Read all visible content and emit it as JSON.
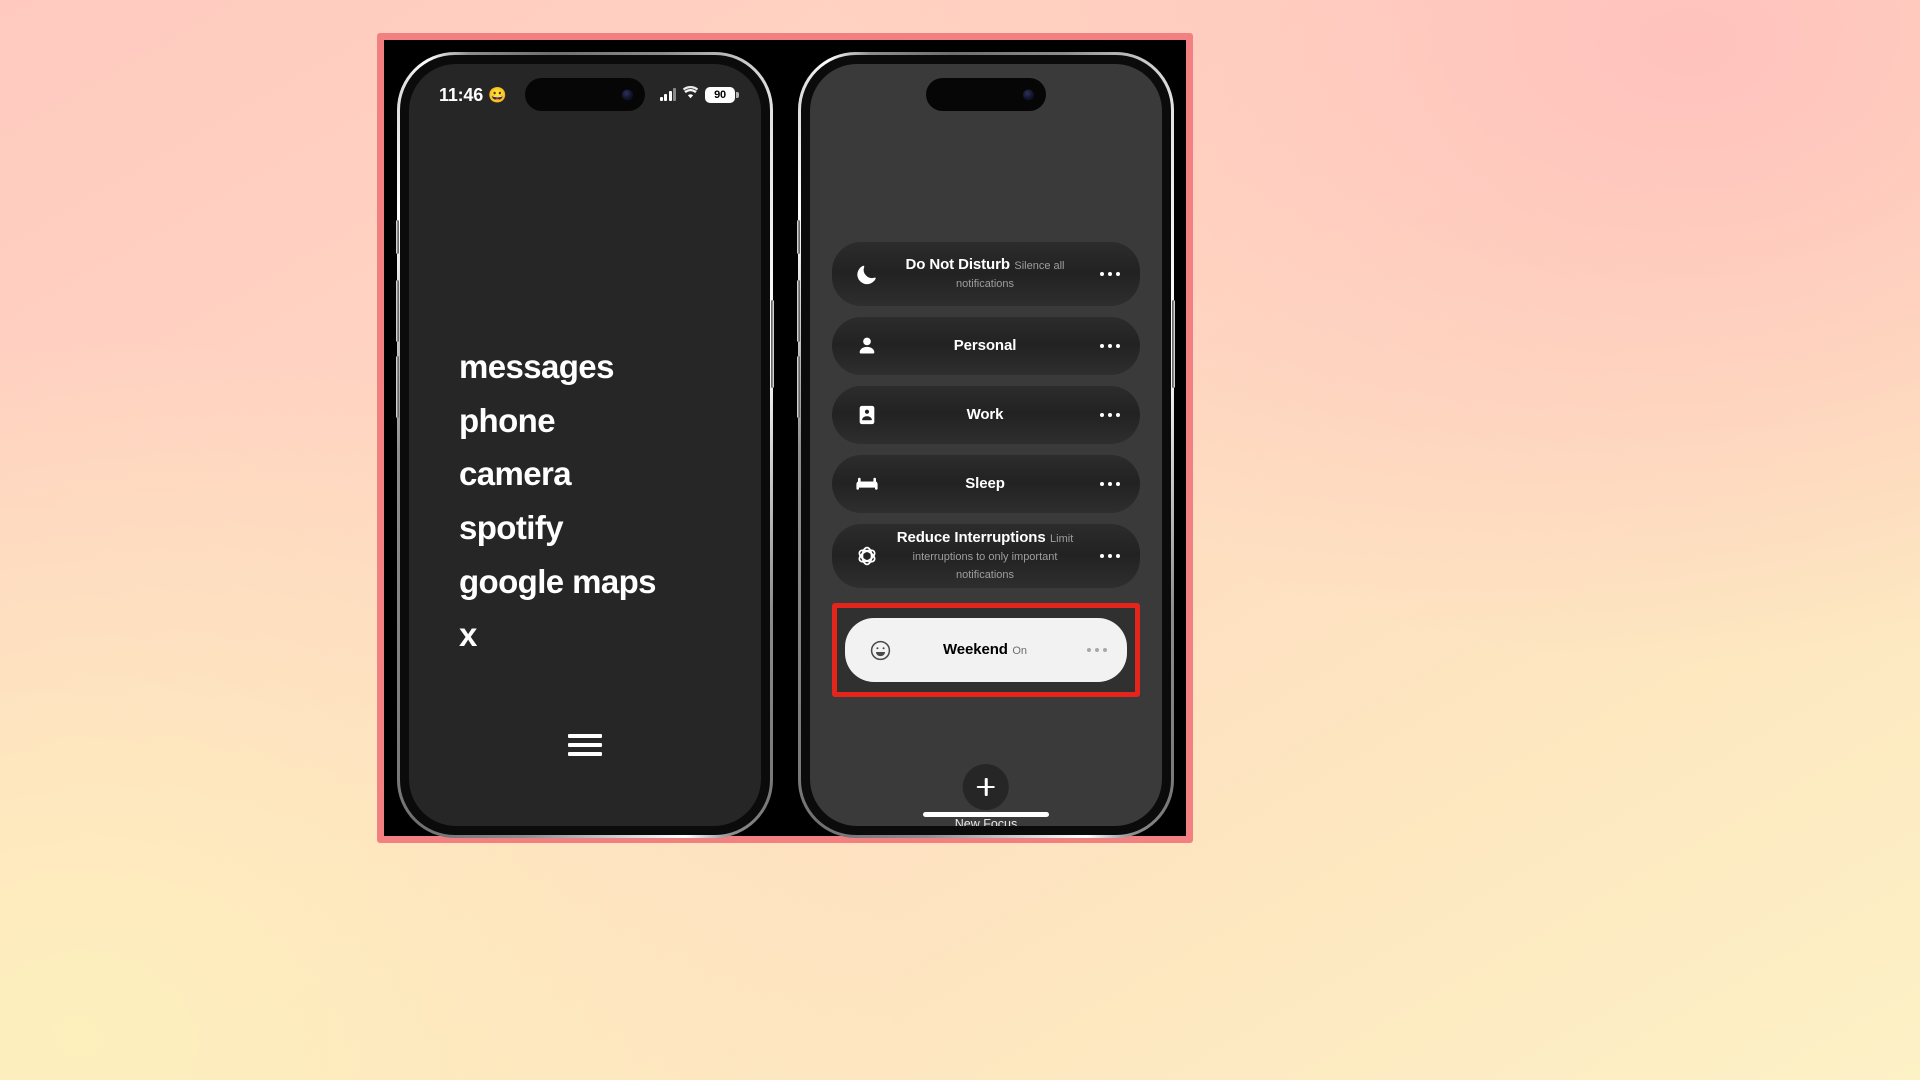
{
  "theme": {
    "background_gradient_from": "#ffc9c0",
    "background_gradient_to": "#fdf1c6",
    "frame_border_color": "#f28080",
    "highlight_box_color": "#e5251c",
    "active_row_background": "#f2f2f2"
  },
  "left_phone": {
    "status_bar": {
      "time": "11:46",
      "time_emoji": "😀",
      "signal_icon": "cellular-signal-icon",
      "wifi_icon": "wifi-icon",
      "battery_level": "90"
    },
    "apps": [
      {
        "label": "messages"
      },
      {
        "label": "phone"
      },
      {
        "label": "camera"
      },
      {
        "label": "spotify"
      },
      {
        "label": "google maps"
      },
      {
        "label": "x"
      }
    ],
    "menu_icon": "hamburger-menu-icon"
  },
  "right_phone": {
    "focus_modes": [
      {
        "title": "Do Not Disturb",
        "subtitle": "Silence all notifications",
        "icon": "crescent-moon-icon",
        "active": false
      },
      {
        "title": "Personal",
        "subtitle": "",
        "icon": "person-icon",
        "active": false
      },
      {
        "title": "Work",
        "subtitle": "",
        "icon": "id-badge-icon",
        "active": false
      },
      {
        "title": "Sleep",
        "subtitle": "",
        "icon": "bed-icon",
        "active": false
      },
      {
        "title": "Reduce Interruptions",
        "subtitle": "Limit interruptions to only important notifications",
        "icon": "rosette-icon",
        "active": false
      },
      {
        "title": "Weekend",
        "subtitle": "On",
        "icon": "smiley-face-icon",
        "active": true
      }
    ],
    "more_options_icon": "ellipsis-icon",
    "new_focus": {
      "label": "New Focus",
      "icon": "plus-icon"
    }
  }
}
